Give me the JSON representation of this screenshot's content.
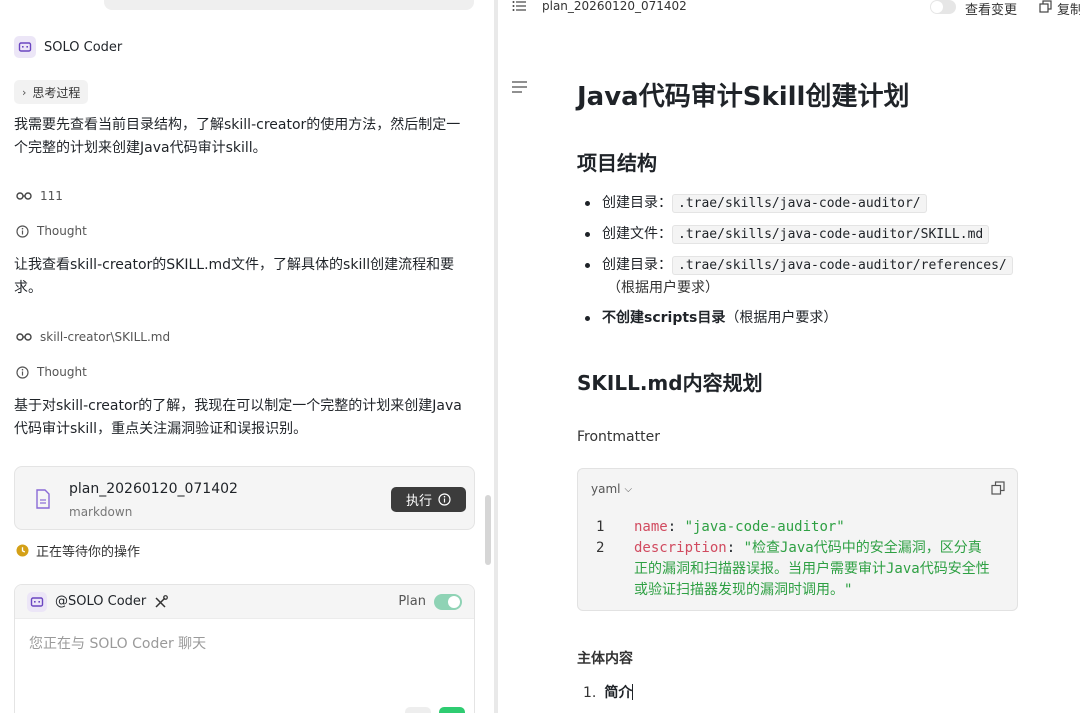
{
  "left": {
    "agent_name": "SOLO Coder",
    "think_chip": "思考过程",
    "para1": "我需要先查看当前目录结构，了解skill-creator的使用方法，然后制定一个完整的计划来创建Java代码审计skill。",
    "tool1": "111",
    "thought1": "Thought",
    "para2": "让我查看skill-creator的SKILL.md文件，了解具体的skill创建流程和要求。",
    "tool2": "skill-creator\\SKILL.md",
    "thought2": "Thought",
    "para3": "基于对skill-creator的了解，我现在可以制定一个完整的计划来创建Java代码审计skill，重点关注漏洞验证和误报识别。",
    "file_card": {
      "name": "plan_20260120_071402",
      "type": "markdown",
      "execute_label": "执行"
    },
    "waiting": "正在等待你的操作",
    "chat": {
      "agent": "@SOLO Coder",
      "plan_label": "Plan",
      "plan_enabled": true,
      "placeholder": "您正在与 SOLO Coder 聊天"
    }
  },
  "right": {
    "tab_title": "plan_20260120_071402",
    "view_changes": "查看变更",
    "copy_label": "复制",
    "doc": {
      "title": "Java代码审计Skill创建计划",
      "section1": "项目结构",
      "bullets": [
        {
          "label": "创建目录：",
          "code": ".trae/skills/java-code-auditor/"
        },
        {
          "label": "创建文件：",
          "code": ".trae/skills/java-code-auditor/SKILL.md"
        },
        {
          "label": "创建目录：",
          "code": ".trae/skills/java-code-auditor/references/",
          "note": "（根据用户要求）"
        }
      ],
      "bullet4_strong": "不创建scripts目录",
      "bullet4_note": "（根据用户要求）",
      "section2": "SKILL.md内容规划",
      "frontmatter": "Frontmatter",
      "code_lang": "yaml",
      "code": {
        "line1_no": "1",
        "line1_key": "name",
        "line1_val": "\"java-code-auditor\"",
        "line2_no": "2",
        "line2_key": "description",
        "line2_val": "\"检查Java代码中的安全漏洞，区分真正的漏洞和扫描器误报。当用户需要审计Java代码安全性或验证扫描器发现的漏洞时调用。\""
      },
      "main_content": "主体内容",
      "ol1_num": "1.",
      "ol1_text": "简介"
    }
  },
  "colors": {
    "accent_green": "#8fd3b5",
    "exec_button": "#3c3c3c",
    "yaml_key": "#d14a5f",
    "yaml_string": "#2ea043",
    "waiting_icon": "#d4a017"
  }
}
